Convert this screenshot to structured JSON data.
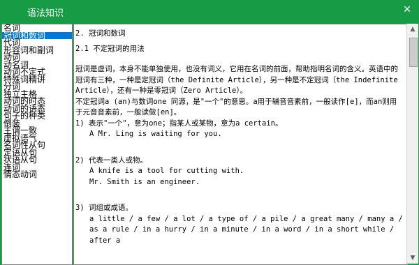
{
  "window": {
    "title": "语法知识"
  },
  "sidebar": {
    "items": [
      {
        "label": "名词",
        "selected": false
      },
      {
        "label": "冠词和数词",
        "selected": true
      },
      {
        "label": "代词",
        "selected": false
      },
      {
        "label": "形容词和副词",
        "selected": false
      },
      {
        "label": "动词",
        "selected": false
      },
      {
        "label": "动名词",
        "selected": false
      },
      {
        "label": "动词不定式",
        "selected": false
      },
      {
        "label": "特殊词精讲",
        "selected": false
      },
      {
        "label": "分词",
        "selected": false
      },
      {
        "label": "独立主格",
        "selected": false
      },
      {
        "label": "动词的时态",
        "selected": false
      },
      {
        "label": "动词的语态",
        "selected": false
      },
      {
        "label": "句子的种类",
        "selected": false
      },
      {
        "label": "倒装",
        "selected": false
      },
      {
        "label": "主谓一致",
        "selected": false
      },
      {
        "label": "虚拟语气",
        "selected": false
      },
      {
        "label": "名词性从句",
        "selected": false
      },
      {
        "label": "定语从句",
        "selected": false
      },
      {
        "label": "状语从句",
        "selected": false
      },
      {
        "label": "连词",
        "selected": false
      },
      {
        "label": "情态动词",
        "selected": false
      }
    ]
  },
  "content": {
    "heading": "2. 冠词和数词",
    "subheading": "2.1 不定冠词的用法",
    "p1": "    冠词是虚词，本身不能单独使用，也没有词义，它用在名词的前面，帮助指明名词的含义。英语中的冠词有三种，一种是定冠词（the Definite Article），另一种是不定冠词（the Indefinite Article），还有一种是零冠词（Zero Article）。",
    "p2": "    不定冠词a (an)与数词one 同源，是\"一个\"的意思。a用于辅音音素前，一般读作[e]，而an则用于元音音素前，一般读做[en]。",
    "item1": "1) 表示\"一个\"，意为one；指某人或某物，意为a certain。",
    "item1_ex": "A Mr. Ling is waiting for you.",
    "item2": "2) 代表一类人或物。",
    "item2_ex1": "A knife is a tool for cutting with.",
    "item2_ex2": "Mr. Smith is an engineer.",
    "item3": "3) 词组或成语。",
    "item3_ex": "a little / a few / a lot / a type of / a pile / a great many / many a / as a rule / in a hurry / in a minute / in a word / in a short while / after a"
  }
}
